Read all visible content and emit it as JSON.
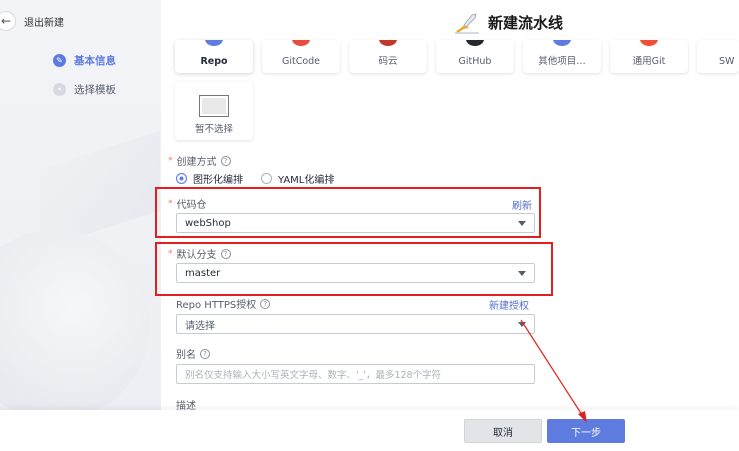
{
  "sidebar": {
    "back_label": "退出新建",
    "steps": [
      {
        "label": "基本信息",
        "state": "active"
      },
      {
        "label": "选择模板",
        "state": "inactive"
      }
    ]
  },
  "header": {
    "title": "新建流水线"
  },
  "repo_sources": [
    {
      "label": "Repo",
      "selected": true
    },
    {
      "label": "GitCode",
      "selected": false
    },
    {
      "label": "码云",
      "selected": false
    },
    {
      "label": "GitHub",
      "selected": false
    },
    {
      "label": "其他项目…",
      "selected": false
    },
    {
      "label": "通用Git",
      "selected": false
    },
    {
      "label": "SW",
      "selected": false
    },
    {
      "label": "暂不选择",
      "selected": false
    }
  ],
  "form": {
    "create_mode": {
      "label": "创建方式",
      "options": [
        "图形化编排",
        "YAML化编排"
      ],
      "selected": "图形化编排"
    },
    "repo": {
      "label": "代码仓",
      "value": "webShop",
      "action": "刷新"
    },
    "branch": {
      "label": "默认分支",
      "value": "master"
    },
    "https_auth": {
      "label": "Repo HTTPS授权",
      "placeholder": "请选择",
      "action": "新建授权"
    },
    "alias": {
      "label": "别名",
      "placeholder": "别名仅支持输入大小写英文字母、数字、'_'，最多128个字符"
    },
    "description": {
      "label": "描述"
    }
  },
  "footer": {
    "cancel_label": "取消",
    "next_label": "下一步"
  },
  "colors": {
    "accent": "#5e7ce0",
    "annotation": "#e02020",
    "required": "#f66f6a"
  }
}
